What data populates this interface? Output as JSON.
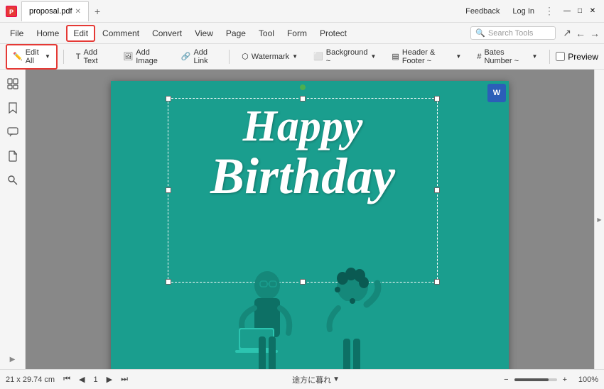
{
  "titlebar": {
    "app_icon": "W",
    "tab_title": "proposal.pdf",
    "feedback": "Feedback",
    "login": "Log In",
    "win_min": "—",
    "win_max": "□",
    "win_close": "✕"
  },
  "menubar": {
    "items": [
      "File",
      "Home",
      "Edit",
      "Comment",
      "Convert",
      "View",
      "Page",
      "Tool",
      "Form",
      "Protect"
    ],
    "active": "Edit",
    "search_placeholder": "Search Tools"
  },
  "toolbar": {
    "edit_all": "Edit All",
    "add_text": "Add Text",
    "add_image": "Add Image",
    "add_link": "Add Link",
    "watermark": "Watermark",
    "background": "Background ~",
    "header_footer": "Header & Footer ~",
    "bates_number": "Bates Number ~",
    "preview": "Preview"
  },
  "sidebar": {
    "icons": [
      "☰",
      "🔖",
      "💬",
      "📎",
      "🔍"
    ]
  },
  "pdf": {
    "happy": "Happy",
    "birthday": "Birthday",
    "bg_color": "#1a9e8e"
  },
  "statusbar": {
    "page_size": "21 x 29.74 cm",
    "page_num": "1",
    "japanese_text": "途方に暮れ",
    "zoom_level": "100%",
    "zoom_plus": "+",
    "zoom_minus": "−"
  },
  "word_icon": "W"
}
